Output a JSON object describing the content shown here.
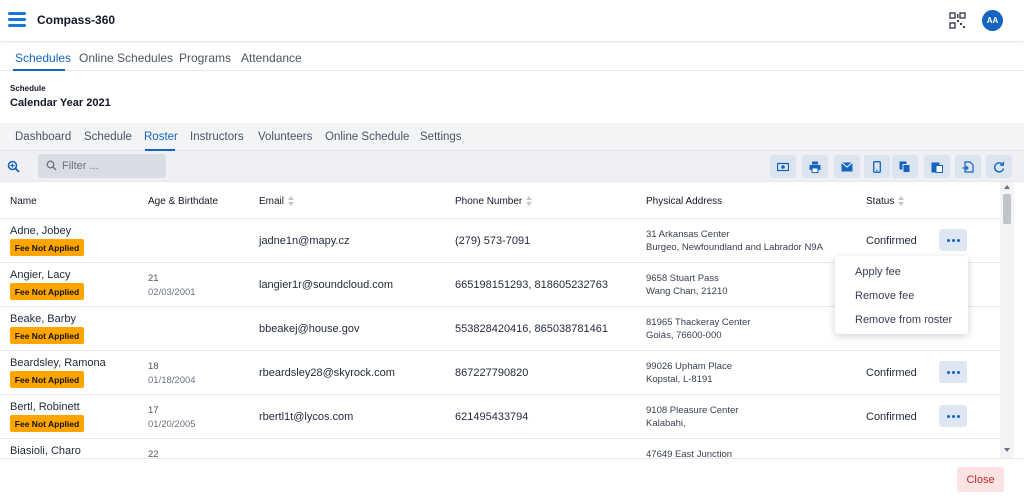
{
  "app": {
    "title": "Compass-360",
    "avatar_initials": "AA"
  },
  "main_tabs": [
    {
      "label": "Schedules",
      "active": true
    },
    {
      "label": "Online Schedules",
      "active": false
    },
    {
      "label": "Programs",
      "active": false
    },
    {
      "label": "Attendance",
      "active": false
    }
  ],
  "schedule": {
    "label": "Schedule",
    "title": "Calendar Year 2021"
  },
  "sub_tabs": [
    {
      "label": "Dashboard",
      "active": false
    },
    {
      "label": "Schedule",
      "active": false
    },
    {
      "label": "Roster",
      "active": true
    },
    {
      "label": "Instructors",
      "active": false
    },
    {
      "label": "Volunteers",
      "active": false
    },
    {
      "label": "Online Schedule",
      "active": false
    },
    {
      "label": "Settings",
      "active": false
    }
  ],
  "toolbar": {
    "filter_placeholder": "Filter ...",
    "icons": [
      "money-icon",
      "print-icon",
      "email-icon",
      "phone-icon",
      "copy-icon",
      "paste-icon",
      "export-icon",
      "refresh-icon"
    ]
  },
  "table": {
    "columns": [
      "Name",
      "Age & Birthdate",
      "Email",
      "Phone Number",
      "Physical Address",
      "Status"
    ],
    "rows": [
      {
        "name": "Adne, Jobey",
        "fee": "Fee Not Applied",
        "age": "",
        "birthdate": "",
        "email": "jadne1n@mapy.cz",
        "phone": "(279) 573-7091",
        "address1": "31 Arkansas Center",
        "address2": "Burgeo, Newfoundland and Labrador N9A",
        "status": "Confirmed"
      },
      {
        "name": "Angier, Lacy",
        "fee": "Fee Not Applied",
        "age": "21",
        "birthdate": "02/03/2001",
        "email": "langier1r@soundcloud.com",
        "phone": "665198151293, 818605232763",
        "address1": "9658 Stuart Pass",
        "address2": "Wang Chan, 21210",
        "status": ""
      },
      {
        "name": "Beake, Barby",
        "fee": "Fee Not Applied",
        "age": "",
        "birthdate": "",
        "email": "bbeakej@house.gov",
        "phone": "553828420416, 865038781461",
        "address1": "81965 Thackeray Center",
        "address2": "Goiás, 76600-000",
        "status": ""
      },
      {
        "name": "Beardsley, Ramona",
        "fee": "Fee Not Applied",
        "age": "18",
        "birthdate": "01/18/2004",
        "email": "rbeardsley28@skyrock.com",
        "phone": "867227790820",
        "address1": "99026 Upham Place",
        "address2": "Kopstal, L-8191",
        "status": "Confirmed"
      },
      {
        "name": "Bertl, Robinett",
        "fee": "Fee Not Applied",
        "age": "17",
        "birthdate": "01/20/2005",
        "email": "rbertl1t@lycos.com",
        "phone": "621495433794",
        "address1": "9108 Pleasure Center",
        "address2": "Kalabahi,",
        "status": "Confirmed"
      },
      {
        "name": "Biasioli, Charo",
        "fee": "",
        "age": "22",
        "birthdate": "",
        "email": "",
        "phone": "",
        "address1": "47649 East Junction",
        "address2": "",
        "status": ""
      }
    ]
  },
  "row_menu": {
    "items": [
      "Apply fee",
      "Remove fee",
      "Remove from roster"
    ]
  },
  "footer": {
    "close_label": "Close"
  },
  "colors": {
    "accent": "#1565c0",
    "fee_badge": "#ffa500",
    "close_text": "#c62828"
  }
}
